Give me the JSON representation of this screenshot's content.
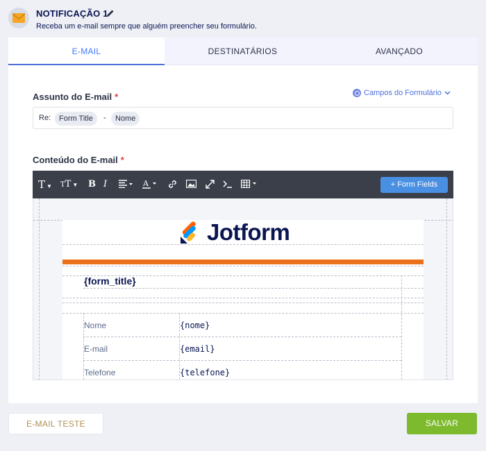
{
  "header": {
    "title": "NOTIFICAÇÃO 1",
    "subtitle": "Receba um e-mail sempre que alguém preencher seu formulário."
  },
  "tabs": [
    {
      "label": "E-MAIL",
      "active": true
    },
    {
      "label": "DESTINATÁRIOS",
      "active": false
    },
    {
      "label": "AVANÇADO",
      "active": false
    }
  ],
  "subject": {
    "label": "Assunto do E-mail",
    "required_mark": "*",
    "form_fields_link": "Campos do Formulário",
    "prefix": "Re:",
    "separator": "-",
    "chips": [
      "Form Title",
      "Nome"
    ]
  },
  "content": {
    "label": "Conteúdo do E-mail",
    "required_mark": "*",
    "toolbar": {
      "icons": [
        "font-family-icon",
        "font-size-icon",
        "bold-icon",
        "italic-icon",
        "align-icon",
        "text-color-icon",
        "link-icon",
        "image-icon",
        "fullscreen-icon",
        "code-icon",
        "table-icon"
      ],
      "bold_glyph": "B",
      "italic_glyph": "I",
      "form_fields_button": "+ Form Fields"
    },
    "email_preview": {
      "logo_text": "Jotform",
      "form_title_var": "{form_title}",
      "rows": [
        {
          "label": "Nome",
          "value": "{nome}"
        },
        {
          "label": "E-mail",
          "value": "{email}"
        },
        {
          "label": "Telefone",
          "value": "{telefone}"
        }
      ]
    }
  },
  "footer": {
    "test_button": "E-MAIL TESTE",
    "save_button": "SALVAR"
  },
  "colors": {
    "accent": "#4c6fd8",
    "save_green": "#7dba2d",
    "orange_bar": "#e9711c",
    "toolbar_bg": "#3b3f4a"
  }
}
